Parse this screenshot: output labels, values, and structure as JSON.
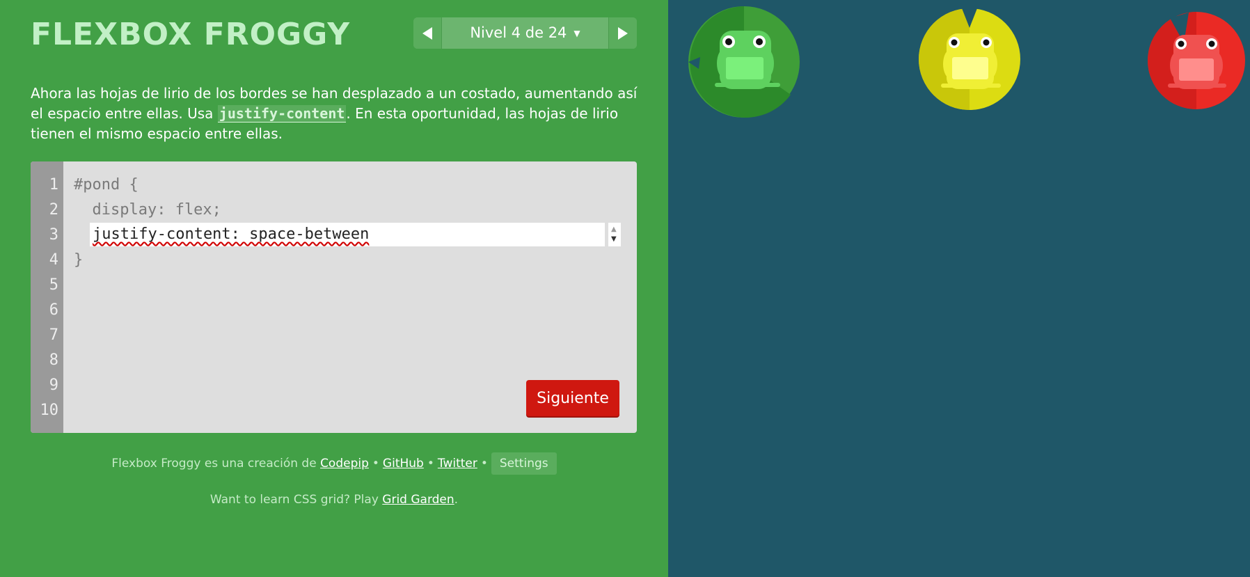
{
  "app": {
    "title": "Flexbox Froggy"
  },
  "level_nav": {
    "label": "Nivel 4 de 24",
    "prev_icon": "triangle-left-icon",
    "next_icon": "triangle-right-icon",
    "caret_icon": "caret-down-icon"
  },
  "instructions": {
    "part1": "Ahora las hojas de lirio de los bordes se han desplazado a un costado, aumentando así el espacio entre ellas. Usa ",
    "code": "justify-content",
    "part2": ". En esta oportunidad, las hojas de lirio tienen el mismo espacio entre ellas."
  },
  "editor": {
    "line_numbers": [
      "1",
      "2",
      "3",
      "4",
      "5",
      "6",
      "7",
      "8",
      "9",
      "10"
    ],
    "line1": "#pond {",
    "line2": "  display: flex;",
    "input_value": "justify-content: space-between",
    "line4": "}",
    "next_label": "Siguiente"
  },
  "credits": {
    "prefix": "Flexbox Froggy es una creación de",
    "codepip": "Codepip",
    "github": "GitHub",
    "twitter": "Twitter",
    "separator": "•",
    "settings": "Settings"
  },
  "grid_promo": {
    "prefix": "Want to learn CSS grid? Play",
    "link": "Grid Garden",
    "suffix": "."
  },
  "pond": {
    "frogs": [
      {
        "color": "green",
        "lily_color": "#2f9a33",
        "frog_color": "#6ddf6f"
      },
      {
        "color": "yellow",
        "lily_color": "#c9c70a",
        "frog_color": "#f5f53a"
      },
      {
        "color": "red",
        "lily_color": "#d31f1c",
        "frog_color": "#ff6a66"
      }
    ]
  },
  "colors": {
    "sidebar_bg": "#42a046",
    "pond_bg": "#1f5768",
    "button_red": "#cf1810"
  }
}
